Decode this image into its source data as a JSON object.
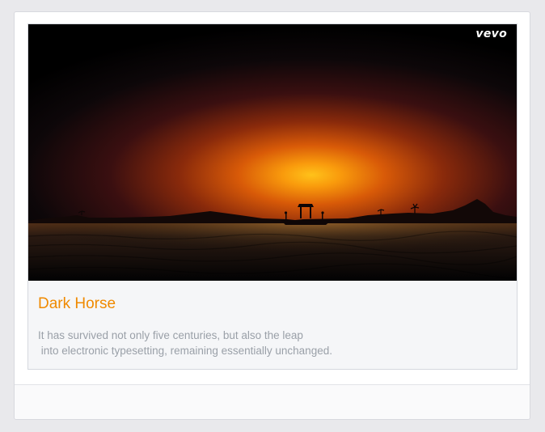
{
  "video": {
    "brand": "vevo",
    "title": "Dark Horse",
    "description": "It has survived not only five centuries, but also the leap\n into electronic typesetting, remaining essentially unchanged."
  },
  "colors": {
    "title": "#f08a00",
    "description": "#9aa0a8",
    "sun": "#ffb300"
  }
}
